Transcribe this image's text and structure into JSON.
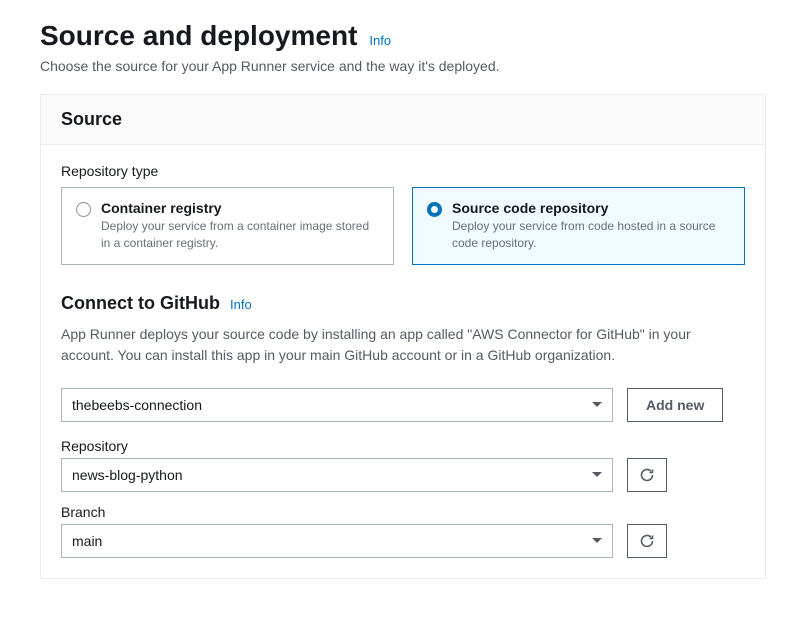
{
  "page": {
    "title": "Source and deployment",
    "info_link": "Info",
    "subtitle": "Choose the source for your App Runner service and the way it's deployed."
  },
  "panel": {
    "header": "Source"
  },
  "repo_type": {
    "label": "Repository type",
    "options": [
      {
        "title": "Container registry",
        "desc": "Deploy your service from a container image stored in a container registry."
      },
      {
        "title": "Source code repository",
        "desc": "Deploy your service from code hosted in a source code repository."
      }
    ]
  },
  "github": {
    "heading": "Connect to GitHub",
    "info_link": "Info",
    "help": "App Runner deploys your source code by installing an app called \"AWS Connector for GitHub\" in your account. You can install this app in your main GitHub account or in a GitHub organization.",
    "connection_value": "thebeebs-connection",
    "add_new": "Add new",
    "repo_label": "Repository",
    "repo_value": "news-blog-python",
    "branch_label": "Branch",
    "branch_value": "main"
  }
}
